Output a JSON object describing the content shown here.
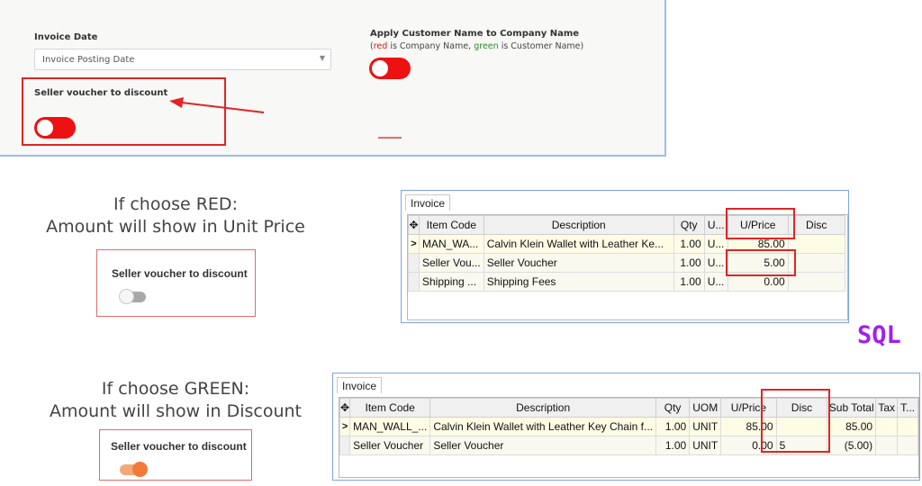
{
  "settings": {
    "invoice_date_label": "Invoice Date",
    "invoice_date_value": "Invoice Posting Date",
    "seller_voucher_label": "Seller voucher to discount",
    "apply_label": "Apply Customer Name to Company Name",
    "hint_open": "(",
    "hint_red": "red",
    "hint_mid": " is Company Name, ",
    "hint_green": "green",
    "hint_end": " is Customer Name)",
    "toggle_color": "#ee1111"
  },
  "red_section": {
    "caption_line1": "If choose RED:",
    "caption_line2": "Amount will show in Unit Price",
    "toggle_label": "Seller voucher to discount"
  },
  "green_section": {
    "caption_line1": "If choose GREEN:",
    "caption_line2": "Amount will show in Discount",
    "toggle_label": "Seller voucher to discount"
  },
  "grid_red": {
    "tab": "Invoice",
    "columns": [
      "Item Code",
      "Description",
      "Qty",
      "U...",
      "U/Price",
      "Disc"
    ],
    "rows": [
      {
        "indicator": ">",
        "cells": [
          "MAN_WA...",
          "Calvin Klein Wallet with Leather Ke...",
          "1.00",
          "U...",
          "85.00",
          ""
        ]
      },
      {
        "indicator": "",
        "cells": [
          "Seller Vou...",
          "Seller Voucher",
          "1.00",
          "U...",
          "5.00",
          ""
        ]
      },
      {
        "indicator": "",
        "cells": [
          "Shipping ...",
          "Shipping Fees",
          "1.00",
          "U...",
          "0.00",
          ""
        ]
      }
    ]
  },
  "grid_green": {
    "tab": "Invoice",
    "columns": [
      "Item Code",
      "Description",
      "Qty",
      "UOM",
      "U/Price",
      "Disc",
      "Sub Total",
      "Tax",
      "T..."
    ],
    "rows": [
      {
        "indicator": ">",
        "cells": [
          "MAN_WALL_...",
          "Calvin Klein Wallet with Leather Key Chain f...",
          "1.00",
          "UNIT",
          "85.00",
          "",
          "85.00",
          "",
          ""
        ]
      },
      {
        "indicator": "",
        "cells": [
          "Seller Voucher",
          "Seller Voucher",
          "1.00",
          "UNIT",
          "0.00",
          "5",
          "(5.00)",
          "",
          ""
        ]
      }
    ]
  },
  "logo": "SQL",
  "colors": {
    "red": "#e02424",
    "orange": "#f07a3a",
    "purple": "#a020f0",
    "border_blue": "#7ea3e6"
  }
}
